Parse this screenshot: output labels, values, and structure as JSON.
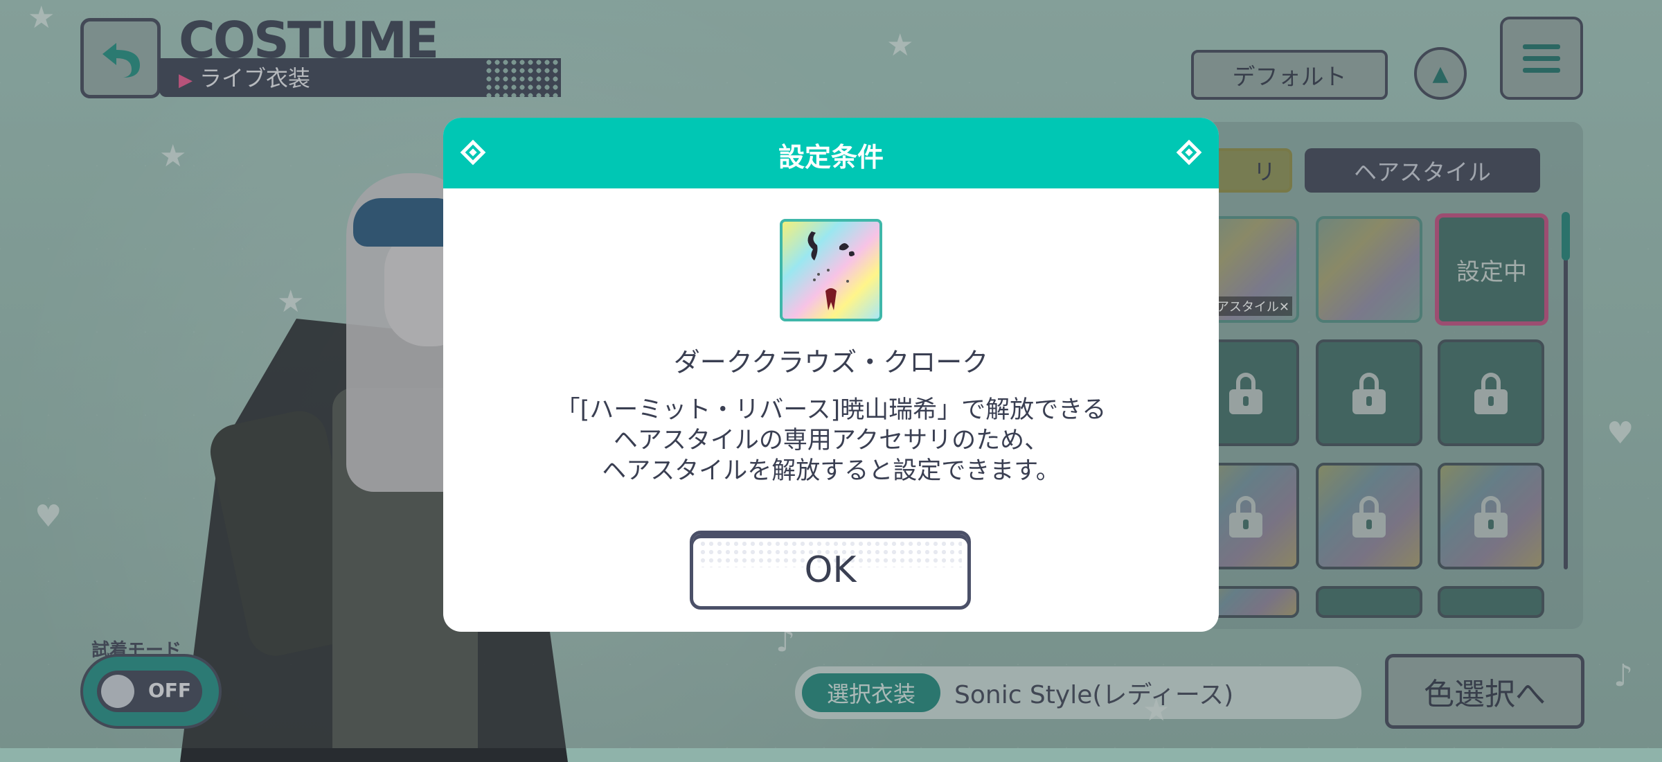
{
  "header": {
    "title": "COSTUME",
    "subtitle": "ライブ衣装",
    "default_button": "デフォルト"
  },
  "tabs": {
    "accessory_partial": "リ",
    "hairstyle": "ヘアスタイル"
  },
  "grid": {
    "tile0_badge": "アスタイル✕",
    "selected_label": "設定中"
  },
  "bottom": {
    "try_on_label": "試着モード",
    "toggle_state": "OFF",
    "selected_costume_label": "選択衣装",
    "selected_costume_value": "Sonic Style(レディース)",
    "color_button": "色選択へ"
  },
  "dialog": {
    "title": "設定条件",
    "item_name": "ダーククラウズ・クローク",
    "desc_line1": "「[ハーミット・リバース]暁山瑞希」で解放できる",
    "desc_line2": "ヘアスタイルの専用アクセサリのため、",
    "desc_line3": "ヘアスタイルを解放すると設定できます。",
    "ok_label": "OK"
  },
  "colors": {
    "accent_teal": "#00c7b4",
    "dark_navy": "#3a3f52",
    "selected_pink": "#c0487c"
  }
}
